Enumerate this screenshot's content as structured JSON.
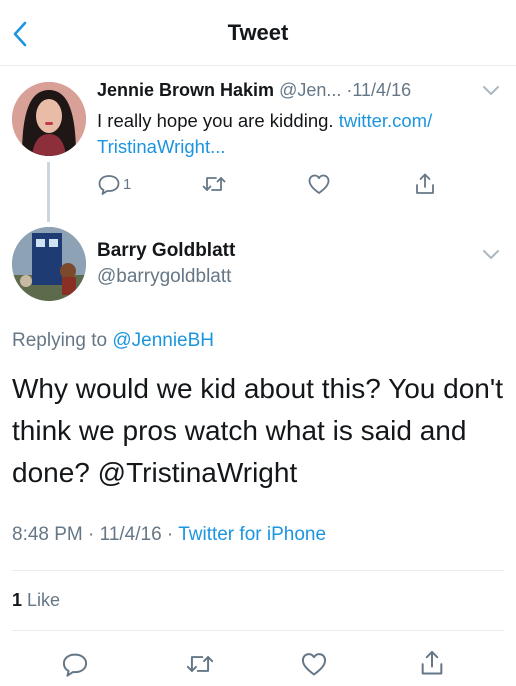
{
  "header": {
    "title": "Tweet",
    "back_icon": "chevron-left-icon",
    "accent_color": "#1b95e0"
  },
  "parent_tweet": {
    "author_name": "Jennie Brown Hakim",
    "author_handle": "@Jen...",
    "separator": "·",
    "date": "11/4/16",
    "text_plain": "I really hope you are kidding.",
    "text_link": "twitter.com/ TristinaWright...",
    "reply_count": "1",
    "icons": [
      "reply-icon",
      "retweet-icon",
      "like-icon",
      "share-icon"
    ]
  },
  "main_tweet": {
    "author_name": "Barry Goldblatt",
    "author_handle": "@barrygoldblatt",
    "replying_to_label": "Replying to",
    "replying_to_handle": "@JennieBH",
    "text": "Why would we kid about this? You don't think we pros watch what is said and done?",
    "mention": "@TristinaWright",
    "time": "8:48 PM",
    "date": "11/4/16",
    "dot": "·",
    "source": "Twitter for iPhone",
    "like_count": "1",
    "like_label": "Like",
    "icons": [
      "reply-icon",
      "retweet-icon",
      "like-icon",
      "share-icon"
    ]
  }
}
